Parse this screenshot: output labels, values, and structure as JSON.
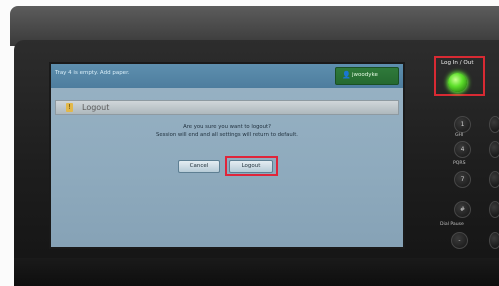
{
  "status_bar": {
    "message": "Tray 4 is empty. Add paper.",
    "user_icon": "user-icon",
    "username": "jwoodyke"
  },
  "dialog": {
    "title": "Logout",
    "warning_icon": "warning-icon",
    "question": "Are you sure you want to logout?",
    "detail": "Session will end and all settings will return to default.",
    "cancel_label": "Cancel",
    "logout_label": "Logout"
  },
  "hardware": {
    "login_label": "Log In / Out",
    "keypad": {
      "key_1": "1",
      "key_4": "4",
      "key_7": "7",
      "key_hash": "#",
      "key_minus": "-",
      "label_ghi": "GHI",
      "label_pqrs": "PQRS",
      "label_dial_pause": "Dial Pause"
    }
  },
  "colors": {
    "highlight": "#e0253a",
    "led": "#5ee02b"
  }
}
